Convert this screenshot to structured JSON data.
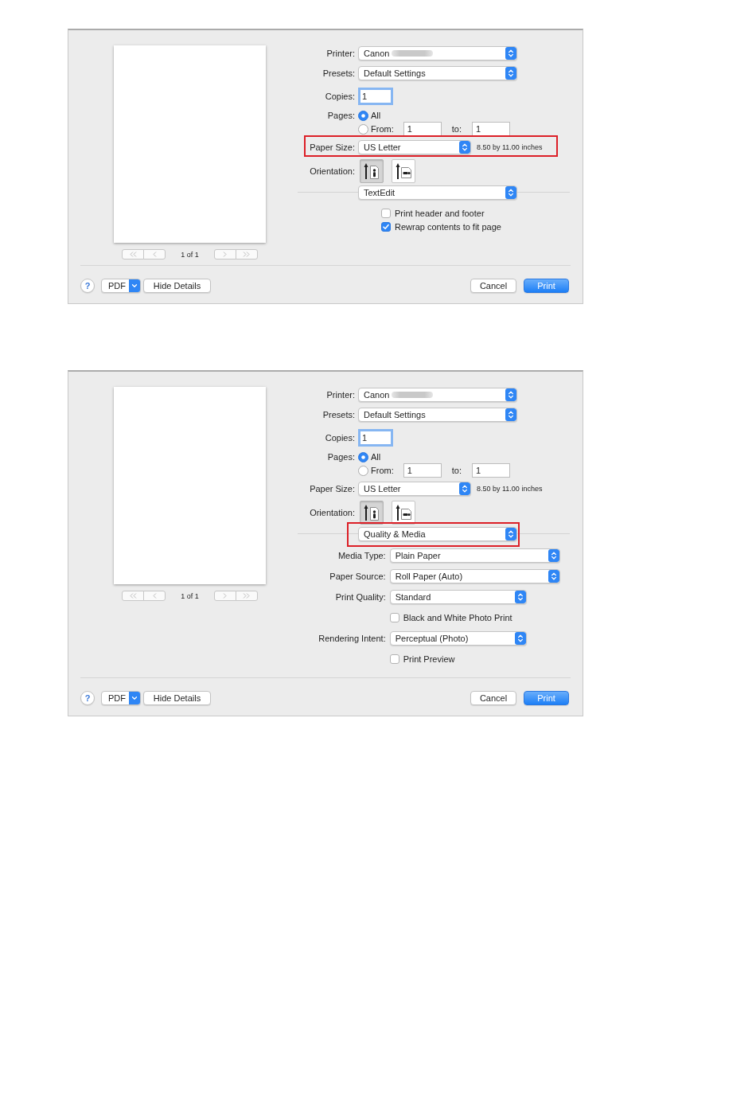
{
  "dialogs": [
    {
      "preview": {
        "back_buttons": [
          {
            "kind": "first",
            "disabled": true
          },
          {
            "kind": "previous",
            "disabled": true
          }
        ],
        "page_indicator": "1 of 1",
        "forward_buttons": [
          {
            "kind": "next",
            "disabled": true
          },
          {
            "kind": "last",
            "disabled": true
          }
        ]
      },
      "fields": [
        {
          "kind": "popup",
          "label": "Printer:",
          "value": "Canon",
          "redacted": true,
          "highlighted": false
        },
        {
          "kind": "popup",
          "label": "Presets:",
          "value": "Default Settings",
          "highlighted": false
        },
        {
          "kind": "number",
          "label": "Copies:",
          "value": "1",
          "focused": true,
          "highlighted": false
        },
        {
          "kind": "pages",
          "label": "Pages:",
          "choices": [
            {
              "label": "All",
              "selected": true
            },
            {
              "label": "From:",
              "selected": false
            }
          ],
          "from": "1",
          "to_label": "to:",
          "to": "1",
          "highlighted": false
        },
        {
          "kind": "popup",
          "label": "Paper Size:",
          "value": "US Letter",
          "note": "8.50 by 11.00 inches",
          "highlighted": true
        },
        {
          "kind": "orientation",
          "label": "Orientation:",
          "choices": [
            {
              "kind": "portrait",
              "selected": true
            },
            {
              "kind": "landscape",
              "selected": false
            }
          ],
          "highlighted": false
        }
      ],
      "pane": {
        "value": "TextEdit",
        "highlighted": false
      },
      "options": [
        {
          "kind": "checkbox",
          "label": "Print header and footer",
          "checked": false
        },
        {
          "kind": "checkbox",
          "label": "Rewrap contents to fit page",
          "checked": true
        }
      ],
      "footer": {
        "help": "?",
        "pdf": "PDF",
        "details": "Hide Details",
        "cancel": "Cancel",
        "print": "Print"
      }
    },
    {
      "preview": {
        "back_buttons": [
          {
            "kind": "first",
            "disabled": true
          },
          {
            "kind": "previous",
            "disabled": true
          }
        ],
        "page_indicator": "1 of 1",
        "forward_buttons": [
          {
            "kind": "next",
            "disabled": true
          },
          {
            "kind": "last",
            "disabled": true
          }
        ]
      },
      "fields": [
        {
          "kind": "popup",
          "label": "Printer:",
          "value": "Canon",
          "redacted": true,
          "highlighted": false
        },
        {
          "kind": "popup",
          "label": "Presets:",
          "value": "Default Settings",
          "highlighted": false
        },
        {
          "kind": "number",
          "label": "Copies:",
          "value": "1",
          "focused": true,
          "highlighted": false
        },
        {
          "kind": "pages",
          "label": "Pages:",
          "choices": [
            {
              "label": "All",
              "selected": true
            },
            {
              "label": "From:",
              "selected": false
            }
          ],
          "from": "1",
          "to_label": "to:",
          "to": "1",
          "highlighted": false
        },
        {
          "kind": "popup",
          "label": "Paper Size:",
          "value": "US Letter",
          "note": "8.50 by 11.00 inches",
          "highlighted": false
        },
        {
          "kind": "orientation",
          "label": "Orientation:",
          "choices": [
            {
              "kind": "portrait",
              "selected": true
            },
            {
              "kind": "landscape",
              "selected": false
            }
          ],
          "highlighted": false
        }
      ],
      "pane": {
        "value": "Quality & Media",
        "highlighted": true
      },
      "options": [
        {
          "kind": "popup",
          "label": "Media Type:",
          "value": "Plain Paper"
        },
        {
          "kind": "popup",
          "label": "Paper Source:",
          "value": "Roll Paper (Auto)"
        },
        {
          "kind": "popup",
          "label": "Print Quality:",
          "value": "Standard"
        },
        {
          "kind": "checkbox",
          "label": "Black and White Photo Print",
          "checked": false
        },
        {
          "kind": "popup",
          "label": "Rendering Intent:",
          "value": "Perceptual (Photo)"
        },
        {
          "kind": "checkbox",
          "label": "Print Preview",
          "checked": false
        }
      ],
      "footer": {
        "help": "?",
        "pdf": "PDF",
        "details": "Hide Details",
        "cancel": "Cancel",
        "print": "Print"
      }
    }
  ]
}
